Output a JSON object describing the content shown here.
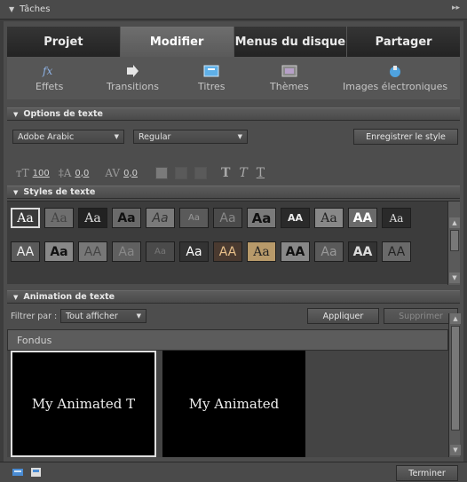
{
  "window": {
    "title": "Tâches"
  },
  "tabs": [
    {
      "label": "Projet"
    },
    {
      "label": "Modifier"
    },
    {
      "label": "Menus du disque"
    },
    {
      "label": "Partager"
    }
  ],
  "tools": [
    {
      "label": "Effets",
      "icon": "fx-icon"
    },
    {
      "label": "Transitions",
      "icon": "arrow-right-icon"
    },
    {
      "label": "Titres",
      "icon": "titles-icon"
    },
    {
      "label": "Thèmes",
      "icon": "themes-icon"
    },
    {
      "label": "Images électroniques",
      "icon": "clip-art-icon"
    }
  ],
  "options": {
    "heading": "Options de texte",
    "font": "Adobe Arabic",
    "style": "Regular",
    "save_style": "Enregistrer le style",
    "size_value": "100",
    "leading_value": "0,0",
    "kerning_value": "0,0"
  },
  "styles": {
    "heading": "Styles de texte",
    "row1": [
      "Aa",
      "Aa",
      "Aa",
      "Aa",
      "Aa",
      "Aa",
      "Aa",
      "Aa",
      "AA",
      "Aa",
      "AA",
      "Aa"
    ],
    "row2": [
      "AA",
      "Aa",
      "AA",
      "Aa",
      "Aa",
      "Aa",
      "AA",
      "Aa",
      "AA",
      "Aa",
      "AA",
      "AA"
    ]
  },
  "animation": {
    "heading": "Animation de texte",
    "filter_label": "Filtrer par :",
    "filter_value": "Tout afficher",
    "apply": "Appliquer",
    "delete": "Supprimer",
    "category": "Fondus",
    "thumbs": [
      {
        "text": "My Animated T"
      },
      {
        "text": "My Animated"
      }
    ]
  },
  "footer": {
    "done": "Terminer"
  }
}
